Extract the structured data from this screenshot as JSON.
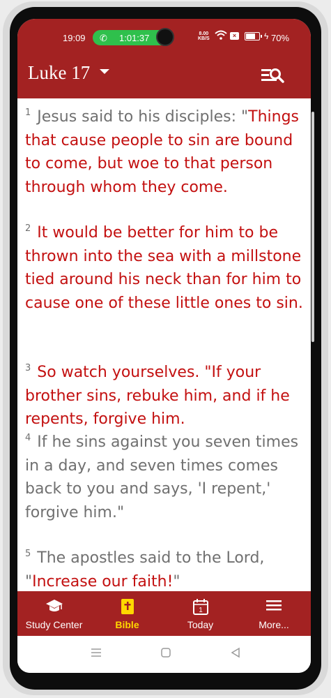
{
  "status_bar": {
    "time": "19:09",
    "call_timer": "1:01:37",
    "net_speed_top": "8.00",
    "net_speed_bottom": "KB/S",
    "battery_pct": "70%",
    "battery_level": 0.7
  },
  "header": {
    "book": "Luke 17",
    "search_icon": "list-search-icon"
  },
  "verses": [
    {
      "num": "1",
      "parts": [
        {
          "text": "Jesus said to his disciples: \"",
          "red": false
        },
        {
          "text": "Things that cause people to sin are bound to come, but woe to that person through whom they come.",
          "red": true
        }
      ]
    },
    {
      "num": "2",
      "parts": [
        {
          "text": "It would be better for him to be thrown into the sea with a millstone tied around his neck than for him to cause one of these little ones to sin.",
          "red": true
        }
      ]
    },
    {
      "num": "3",
      "parts": [
        {
          "text": "So watch yourselves. \"If your brother sins, rebuke him, and if he repents, forgive him.",
          "red": true
        }
      ]
    },
    {
      "num": "4",
      "parts": [
        {
          "text": "If he sins against you seven times in a day, and seven times comes back to you and says, 'I repent,' forgive him.\"",
          "red": false
        }
      ]
    },
    {
      "num": "5",
      "parts": [
        {
          "text": "The apostles said to the Lord, \"",
          "red": false
        },
        {
          "text": "Increase our faith!",
          "red": true
        },
        {
          "text": "\"",
          "red": false
        }
      ]
    }
  ],
  "bottom_nav": [
    {
      "label": "Study Center",
      "icon": "graduation-cap-icon"
    },
    {
      "label": "Bible",
      "icon": "bible-icon",
      "active": true
    },
    {
      "label": "Today",
      "icon": "calendar-icon",
      "day": "1"
    },
    {
      "label": "More...",
      "icon": "menu-icon"
    }
  ],
  "colors": {
    "accent": "#a32222",
    "words_of_jesus": "#c31010",
    "active_nav": "#ffd800"
  }
}
